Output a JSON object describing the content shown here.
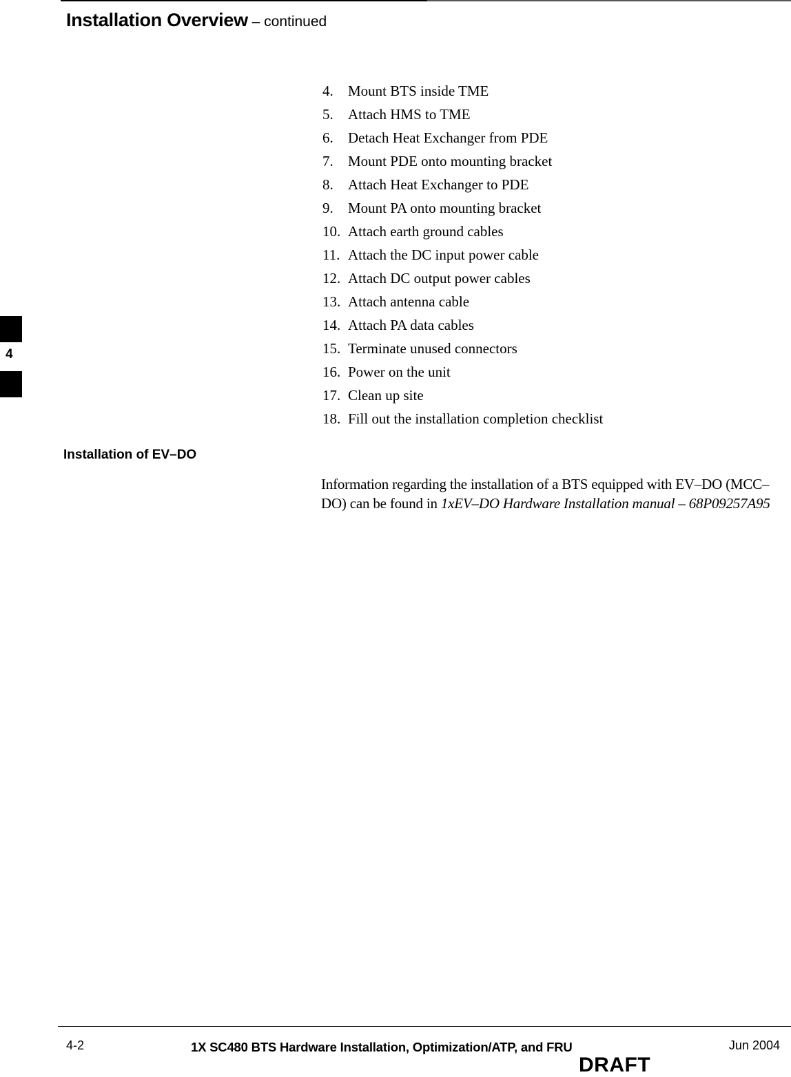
{
  "header": {
    "title": "Installation Overview",
    "continued": " – continued"
  },
  "steps": [
    {
      "num": "4.",
      "text": "Mount BTS inside TME"
    },
    {
      "num": "5.",
      "text": "Attach HMS to TME"
    },
    {
      "num": "6.",
      "text": "Detach Heat Exchanger from PDE"
    },
    {
      "num": "7.",
      "text": "Mount PDE onto mounting bracket"
    },
    {
      "num": "8.",
      "text": "Attach Heat Exchanger to PDE"
    },
    {
      "num": "9.",
      "text": "Mount PA onto mounting bracket"
    },
    {
      "num": "10.",
      "text": "Attach earth ground cables"
    },
    {
      "num": "11.",
      "text": "Attach the DC input power cable"
    },
    {
      "num": "12.",
      "text": "Attach DC output power cables"
    },
    {
      "num": "13.",
      "text": "Attach antenna cable"
    },
    {
      "num": "14.",
      "text": "Attach PA data cables"
    },
    {
      "num": "15.",
      "text": "Terminate unused connectors"
    },
    {
      "num": "16.",
      "text": "Power on the unit"
    },
    {
      "num": "17.",
      "text": "Clean up site"
    },
    {
      "num": "18.",
      "text": "Fill out the installation completion checklist"
    }
  ],
  "section": {
    "heading": "Installation of EV–DO",
    "body_plain": "Information regarding the installation of a BTS equipped with EV–DO (MCC–DO) can be found in ",
    "body_italic": "1xEV–DO Hardware Installation manual – 68P09257A95"
  },
  "side_tab": {
    "chapter": "4"
  },
  "footer": {
    "page_number": "4-2",
    "doc_title": "1X SC480 BTS Hardware Installation, Optimization/ATP, and FRU",
    "date": "Jun 2004",
    "draft": "DRAFT"
  }
}
